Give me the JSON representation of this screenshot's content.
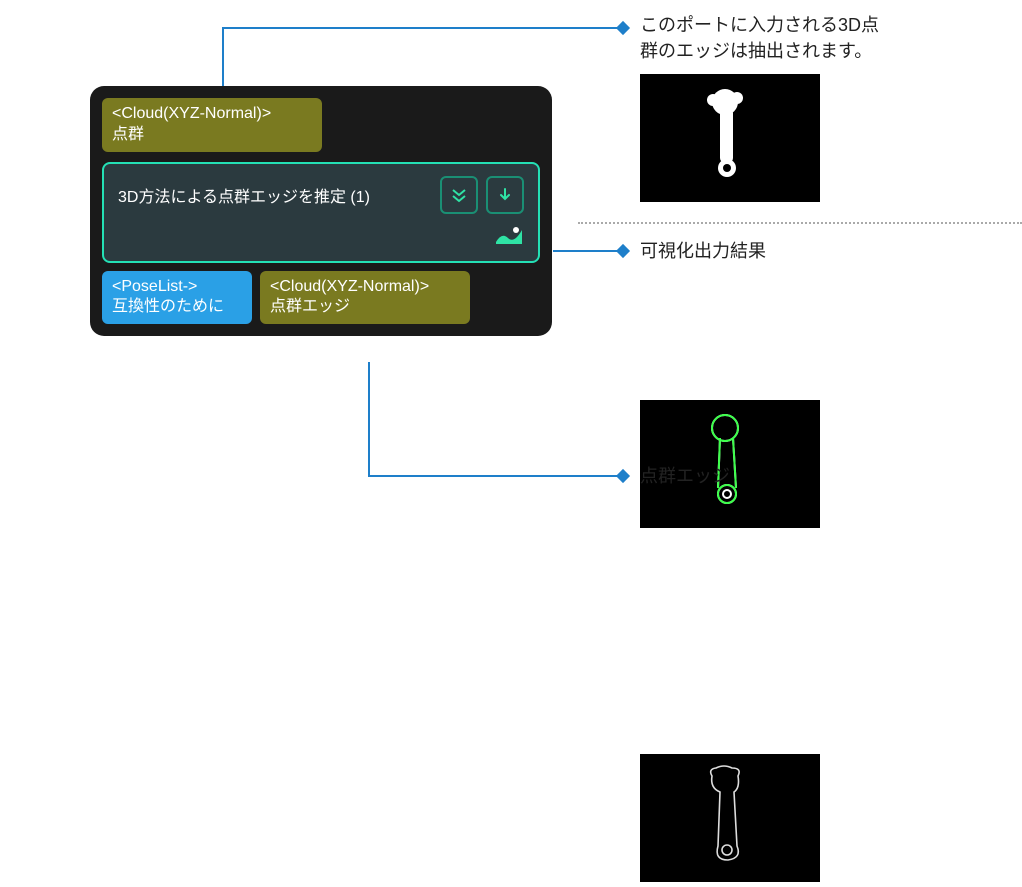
{
  "node": {
    "input_port": {
      "type_label": "<Cloud(XYZ-Normal)>",
      "name": "点群"
    },
    "body": {
      "title": "3D方法による点群エッジを推定 (1)"
    },
    "output_ports": {
      "pose": {
        "type_label": "<PoseList->",
        "name": "互換性のために"
      },
      "cloud": {
        "type_label": "<Cloud(XYZ-Normal)>",
        "name": "点群エッジ"
      }
    }
  },
  "callouts": {
    "input_desc_line1": "このポートに入力される3D点",
    "input_desc_line2": "群のエッジは抽出されます。",
    "vis_label": "可視化出力結果",
    "edge_label": "点群エッジ"
  }
}
